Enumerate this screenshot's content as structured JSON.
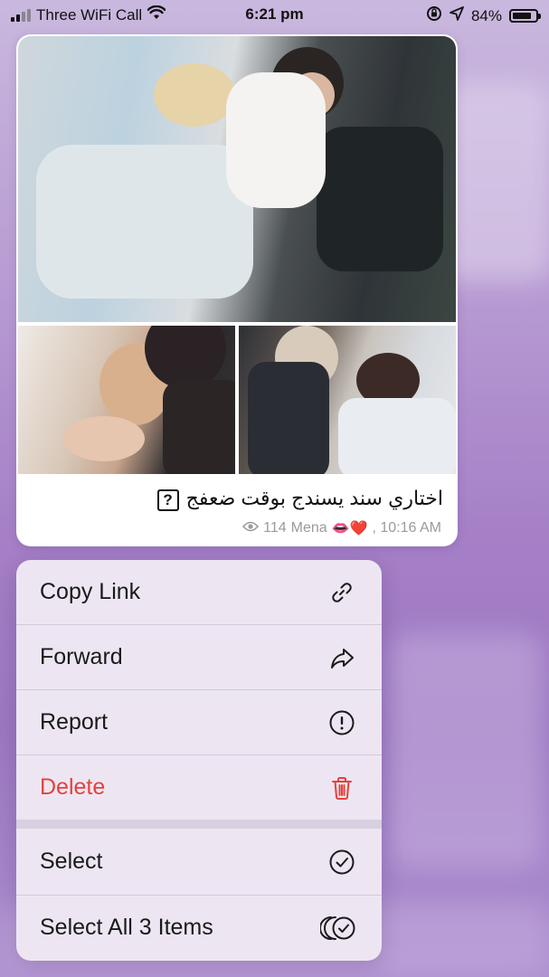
{
  "status_bar": {
    "carrier": "Three WiFi Call",
    "time": "6:21 pm",
    "battery_pct": "84%",
    "battery_level": 0.84,
    "icons": [
      "signal-icon",
      "wifi-icon",
      "rotation-lock-icon",
      "location-icon",
      "battery-icon"
    ]
  },
  "message": {
    "photos": [
      "photo-main",
      "photo-left",
      "photo-right"
    ],
    "caption": "اختاري سند يسندج بوقت ضعفج",
    "caption_badge": "?",
    "views": "114",
    "author": "Mena",
    "reactions": "👄❤️",
    "time": ", 10:16 AM"
  },
  "context_menu": {
    "items": [
      {
        "label": "Copy Link",
        "icon": "link-icon",
        "style": "normal"
      },
      {
        "label": "Forward",
        "icon": "forward-icon",
        "style": "normal"
      },
      {
        "label": "Report",
        "icon": "report-icon",
        "style": "normal"
      },
      {
        "label": "Delete",
        "icon": "trash-icon",
        "style": "destructive"
      },
      {
        "label": "Select",
        "icon": "checkmark-circle-icon",
        "style": "normal"
      },
      {
        "label": "Select All 3 Items",
        "icon": "select-all-icon",
        "style": "normal"
      }
    ],
    "destructive_color": "#e5413c"
  }
}
